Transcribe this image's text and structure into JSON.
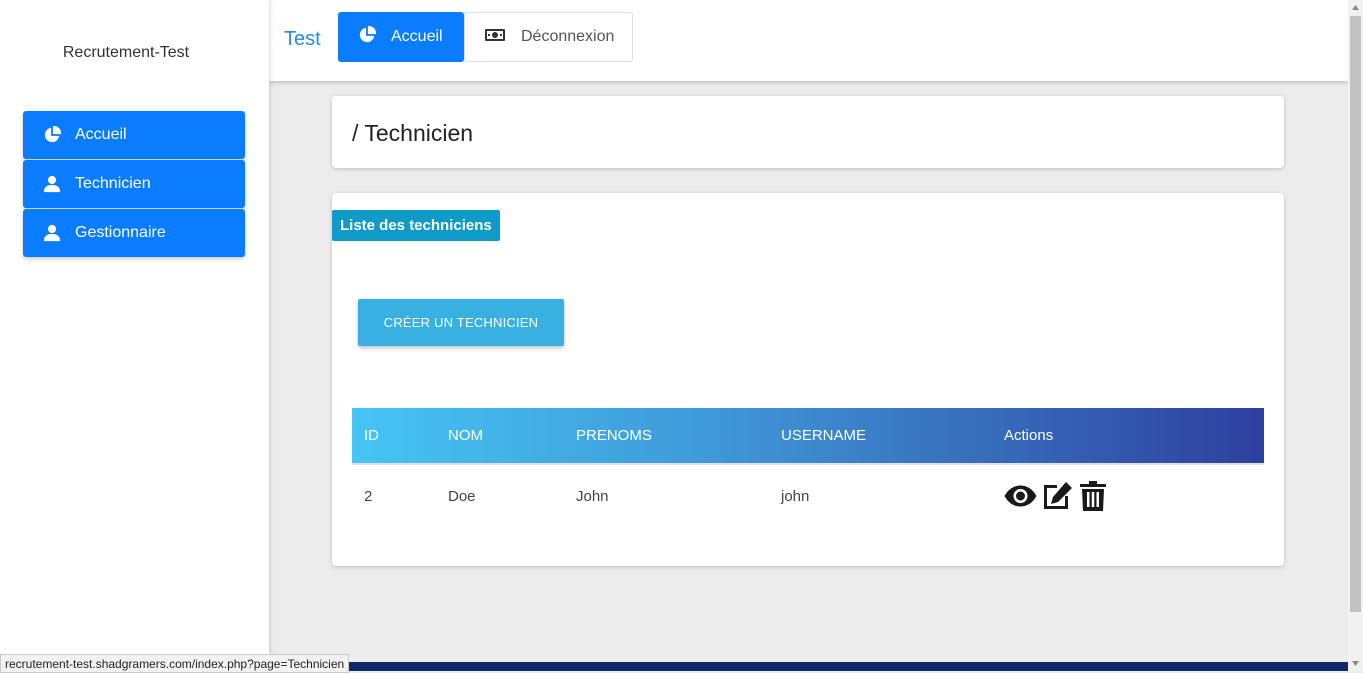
{
  "sidebar": {
    "brand": "Recrutement-Test",
    "items": [
      {
        "label": "Accueil",
        "icon": "pie-chart-icon"
      },
      {
        "label": "Technicien",
        "icon": "user-icon"
      },
      {
        "label": "Gestionnaire",
        "icon": "user-icon"
      }
    ]
  },
  "topbar": {
    "title": "Test",
    "tabs": [
      {
        "label": "Accueil",
        "icon": "pie-chart-icon",
        "active": true
      },
      {
        "label": "Déconnexion",
        "icon": "money-bill-icon",
        "active": false
      }
    ]
  },
  "breadcrumb": "/ Technicien",
  "list": {
    "badge": "Liste des techniciens",
    "create_button": "CRÉER UN TECHNICIEN",
    "columns": [
      "ID",
      "NOM",
      "PRENOMS",
      "USERNAME",
      "Actions"
    ],
    "rows": [
      {
        "id": "2",
        "nom": "Doe",
        "prenoms": "John",
        "username": "john"
      }
    ]
  },
  "status_url": "recrutement-test.shadgramers.com/index.php?page=Technicien",
  "colors": {
    "primary": "#0a7cff",
    "badge": "#0f9ac7",
    "create_button": "#39b0e2",
    "header_gradient_start": "#45c5f5",
    "header_gradient_end": "#2e3f9e"
  }
}
